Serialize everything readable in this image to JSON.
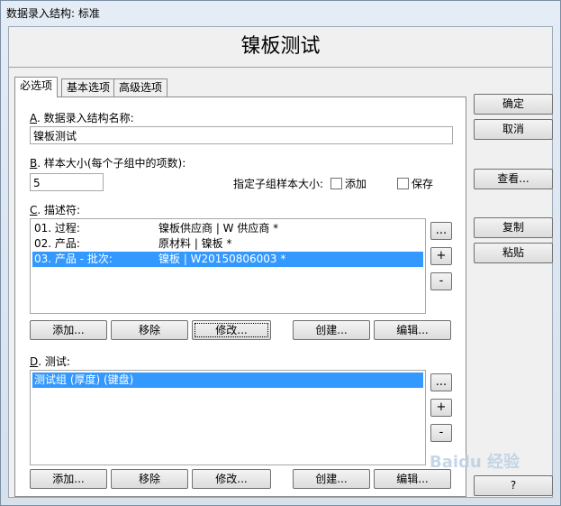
{
  "window": {
    "title": "数据录入结构: 标准"
  },
  "header": {
    "title": "镍板测试"
  },
  "tabs": [
    {
      "label": "必选项",
      "active": true
    },
    {
      "label": "基本选项",
      "active": false
    },
    {
      "label": "高级选项",
      "active": false
    }
  ],
  "section_a": {
    "letter": "A",
    "label": ". 数据录入结构名称:",
    "value": "镍板测试"
  },
  "section_b": {
    "letter": "B",
    "label": ". 样本大小(每个子组中的项数):",
    "value": "5",
    "subgroup_label": "指定子组样本大小:",
    "add_label": "添加",
    "save_label": "保存"
  },
  "section_c": {
    "letter": "C",
    "label": ". 描述符:",
    "rows": [
      {
        "name": "01. 过程:",
        "value": "镍板供应商 | W 供应商 *",
        "selected": false
      },
      {
        "name": "02. 产品:",
        "value": "原材料 | 镍板 *",
        "selected": false
      },
      {
        "name": "03. 产品 - 批次:",
        "value": "镍板 | W20150806003 *",
        "selected": true
      }
    ],
    "side_buttons": {
      "more": "...",
      "plus": "+",
      "minus": "-"
    },
    "buttons": {
      "add": "添加...",
      "remove": "移除",
      "modify": "修改...",
      "create": "创建...",
      "edit": "编辑..."
    }
  },
  "section_d": {
    "letter": "D",
    "label": ". 测试:",
    "rows": [
      {
        "name": "测试组 (厚度) (键盘)",
        "selected": true
      }
    ],
    "side_buttons": {
      "more": "...",
      "plus": "+",
      "minus": "-"
    },
    "buttons": {
      "add": "添加...",
      "remove": "移除",
      "modify": "修改...",
      "create": "创建...",
      "edit": "编辑..."
    }
  },
  "right_buttons": {
    "ok": "确定",
    "cancel": "取消",
    "view": "查看...",
    "copy": "复制",
    "paste": "粘贴",
    "help": "?"
  },
  "watermark": "Baidu 经验",
  "colors": {
    "selection": "#3399ff",
    "panel": "#ffffff",
    "chrome": "#f0f0f0"
  }
}
